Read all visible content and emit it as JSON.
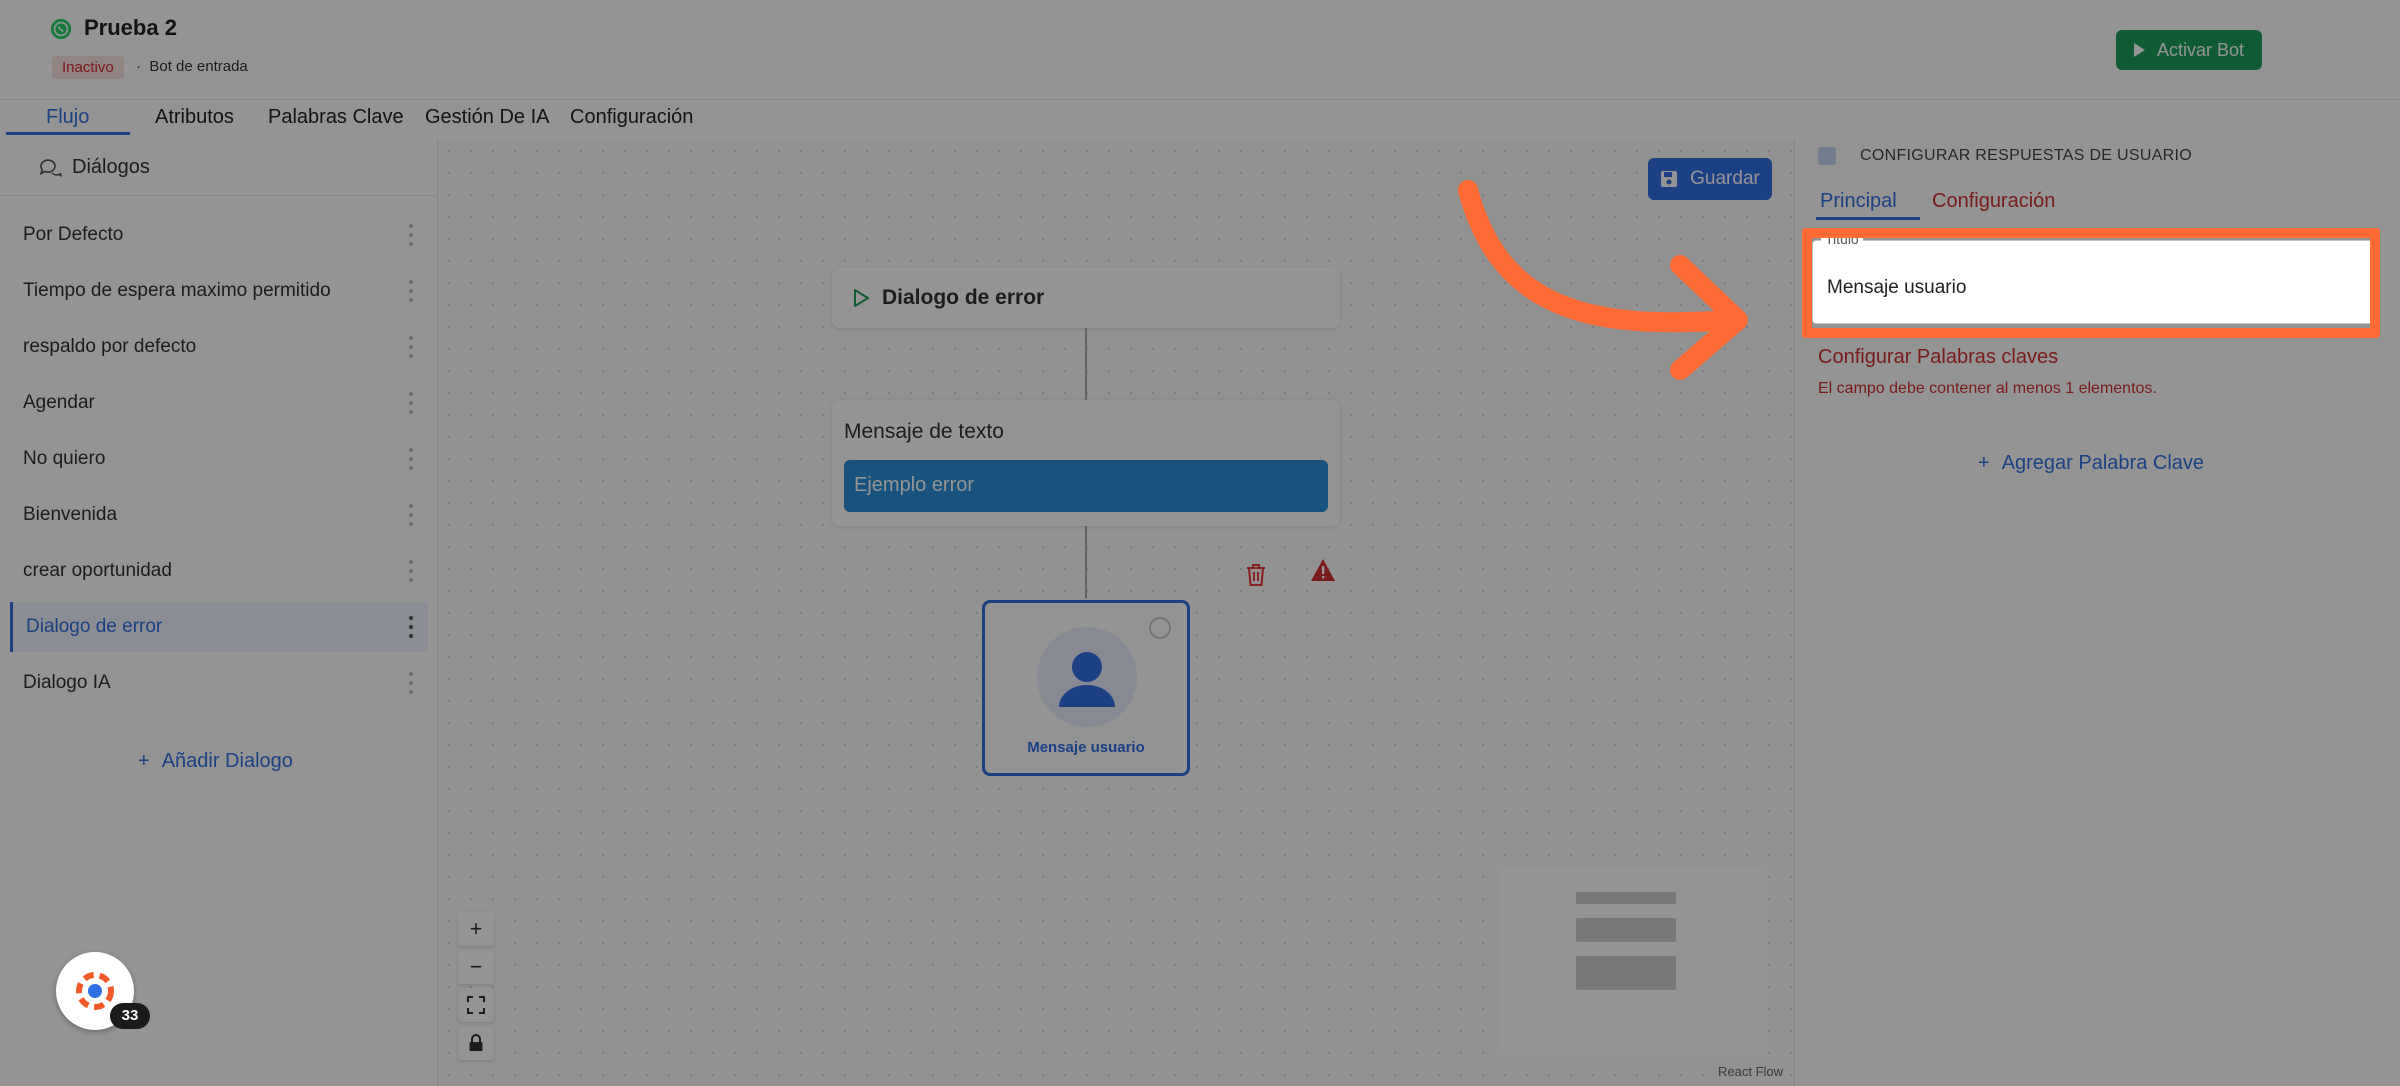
{
  "header": {
    "bot_name": "Prueba 2",
    "status": "Inactivo",
    "separator": "·",
    "bot_type": "Bot de entrada",
    "activate_label": "Activar Bot"
  },
  "tabs": [
    "Flujo",
    "Atributos",
    "Palabras Clave",
    "Gestión De IA",
    "Configuración"
  ],
  "sidebar": {
    "title": "Diálogos",
    "items": [
      {
        "label": "Por Defecto",
        "active": false
      },
      {
        "label": "Tiempo de espera maximo permitido",
        "active": false
      },
      {
        "label": "respaldo por defecto",
        "active": false
      },
      {
        "label": "Agendar",
        "active": false
      },
      {
        "label": "No quiero",
        "active": false
      },
      {
        "label": "Bienvenida",
        "active": false
      },
      {
        "label": "crear oportunidad",
        "active": false
      },
      {
        "label": "Dialogo de error",
        "active": true
      },
      {
        "label": "Dialogo IA",
        "active": false
      }
    ],
    "add_label": "Añadir Dialogo"
  },
  "canvas": {
    "save_label": "Guardar",
    "start_node_title": "Dialogo de error",
    "text_node_title": "Mensaje de texto",
    "text_node_message": "Ejemplo error",
    "user_node_label": "Mensaje usuario",
    "zoom_in": "+",
    "zoom_out": "−",
    "attribution": "React Flow"
  },
  "panel": {
    "title": "CONFIGURAR RESPUESTAS DE USUARIO",
    "tab_main": "Principal",
    "tab_config": "Configuración",
    "field_label": "Titulo",
    "field_value": "Mensaje usuario",
    "keywords_title": "Configurar Palabras claves",
    "keywords_error": "El campo debe contener al menos 1 elementos.",
    "add_keyword_label": "Agregar Palabra Clave"
  },
  "help_widget": {
    "count": "33"
  },
  "colors": {
    "accent": "#2f6fe4",
    "activate": "#1e9e5a",
    "error": "#d32f2f",
    "highlight": "#ff6a35",
    "message_bubble": "#2b8ed6"
  },
  "icons": [
    "whatsapp-icon",
    "play-icon",
    "chat-bubbles-icon",
    "plus-icon",
    "save-icon",
    "trash-icon",
    "warning-icon",
    "user-icon",
    "fit-view-icon",
    "lock-icon",
    "back-icon",
    "curved-arrow"
  ]
}
